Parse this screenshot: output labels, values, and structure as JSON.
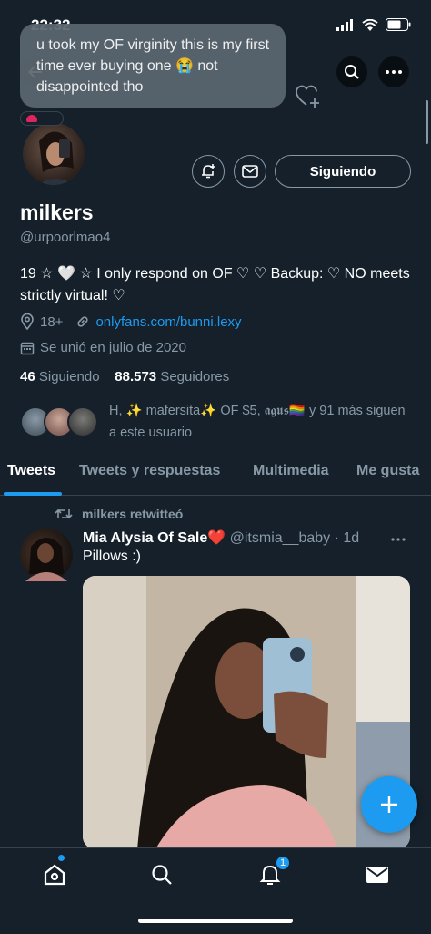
{
  "status_bar": {
    "time": "22:32"
  },
  "tooltip": {
    "text": "u took my OF virginity this is my first time ever buying one 😭 not disappointed tho"
  },
  "profile": {
    "name": "milkers",
    "handle": "@urpoorlmao4",
    "bio": "19 ☆ 🤍 ☆ I only respond on OF ♡ ♡ Backup: ♡ NO meets strictly virtual! ♡",
    "age": "18+",
    "link": "onlyfans.com/bunni.lexy",
    "joined": "Se unió en julio de 2020",
    "following_count": "46",
    "following_label": "Siguiendo",
    "followers_count": "88.573",
    "followers_label": "Seguidores",
    "follow_button": "Siguiendo",
    "known_followers": "H,  ✨ mafersita✨  OF $5, 𝖆𝖌𝖚𝖘🏳️‍🌈  y 91 más siguen a este usuario"
  },
  "tabs": [
    {
      "label": "Tweets"
    },
    {
      "label": "Tweets y respuestas"
    },
    {
      "label": "Multimedia"
    },
    {
      "label": "Me gusta"
    }
  ],
  "tweet": {
    "retweeted_by": "milkers retwitteó",
    "author_name": "Mia Alysia Of Sale❤️",
    "author_meta": "@itsmia__baby · 1d",
    "text": "Pillows :)"
  },
  "nav": {
    "notification_count": "1"
  }
}
